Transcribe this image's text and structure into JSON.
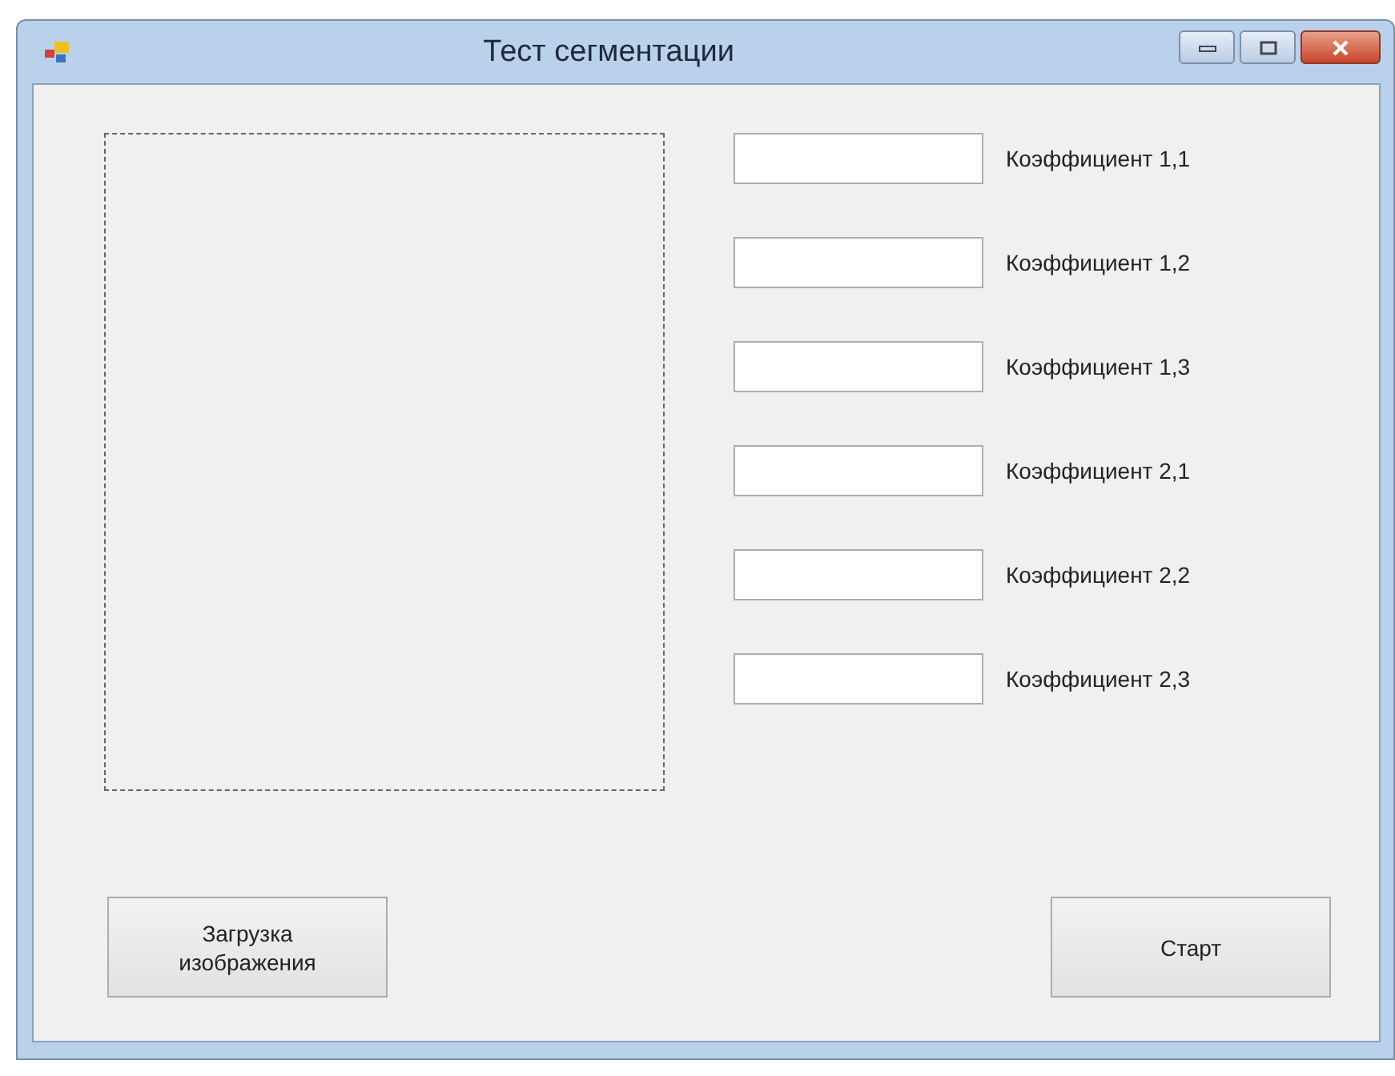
{
  "window": {
    "title": "Тест сегментации"
  },
  "fields": [
    {
      "label": "Коэффициент 1,1"
    },
    {
      "label": "Коэффициент 1,2"
    },
    {
      "label": "Коэффициент 1,3"
    },
    {
      "label": "Коэффициент 2,1"
    },
    {
      "label": "Коэффициент 2,2"
    },
    {
      "label": "Коэффициент 2,3"
    }
  ],
  "buttons": [
    {
      "label": "Загрузка\nизображения"
    },
    {
      "label": "Старт"
    }
  ]
}
